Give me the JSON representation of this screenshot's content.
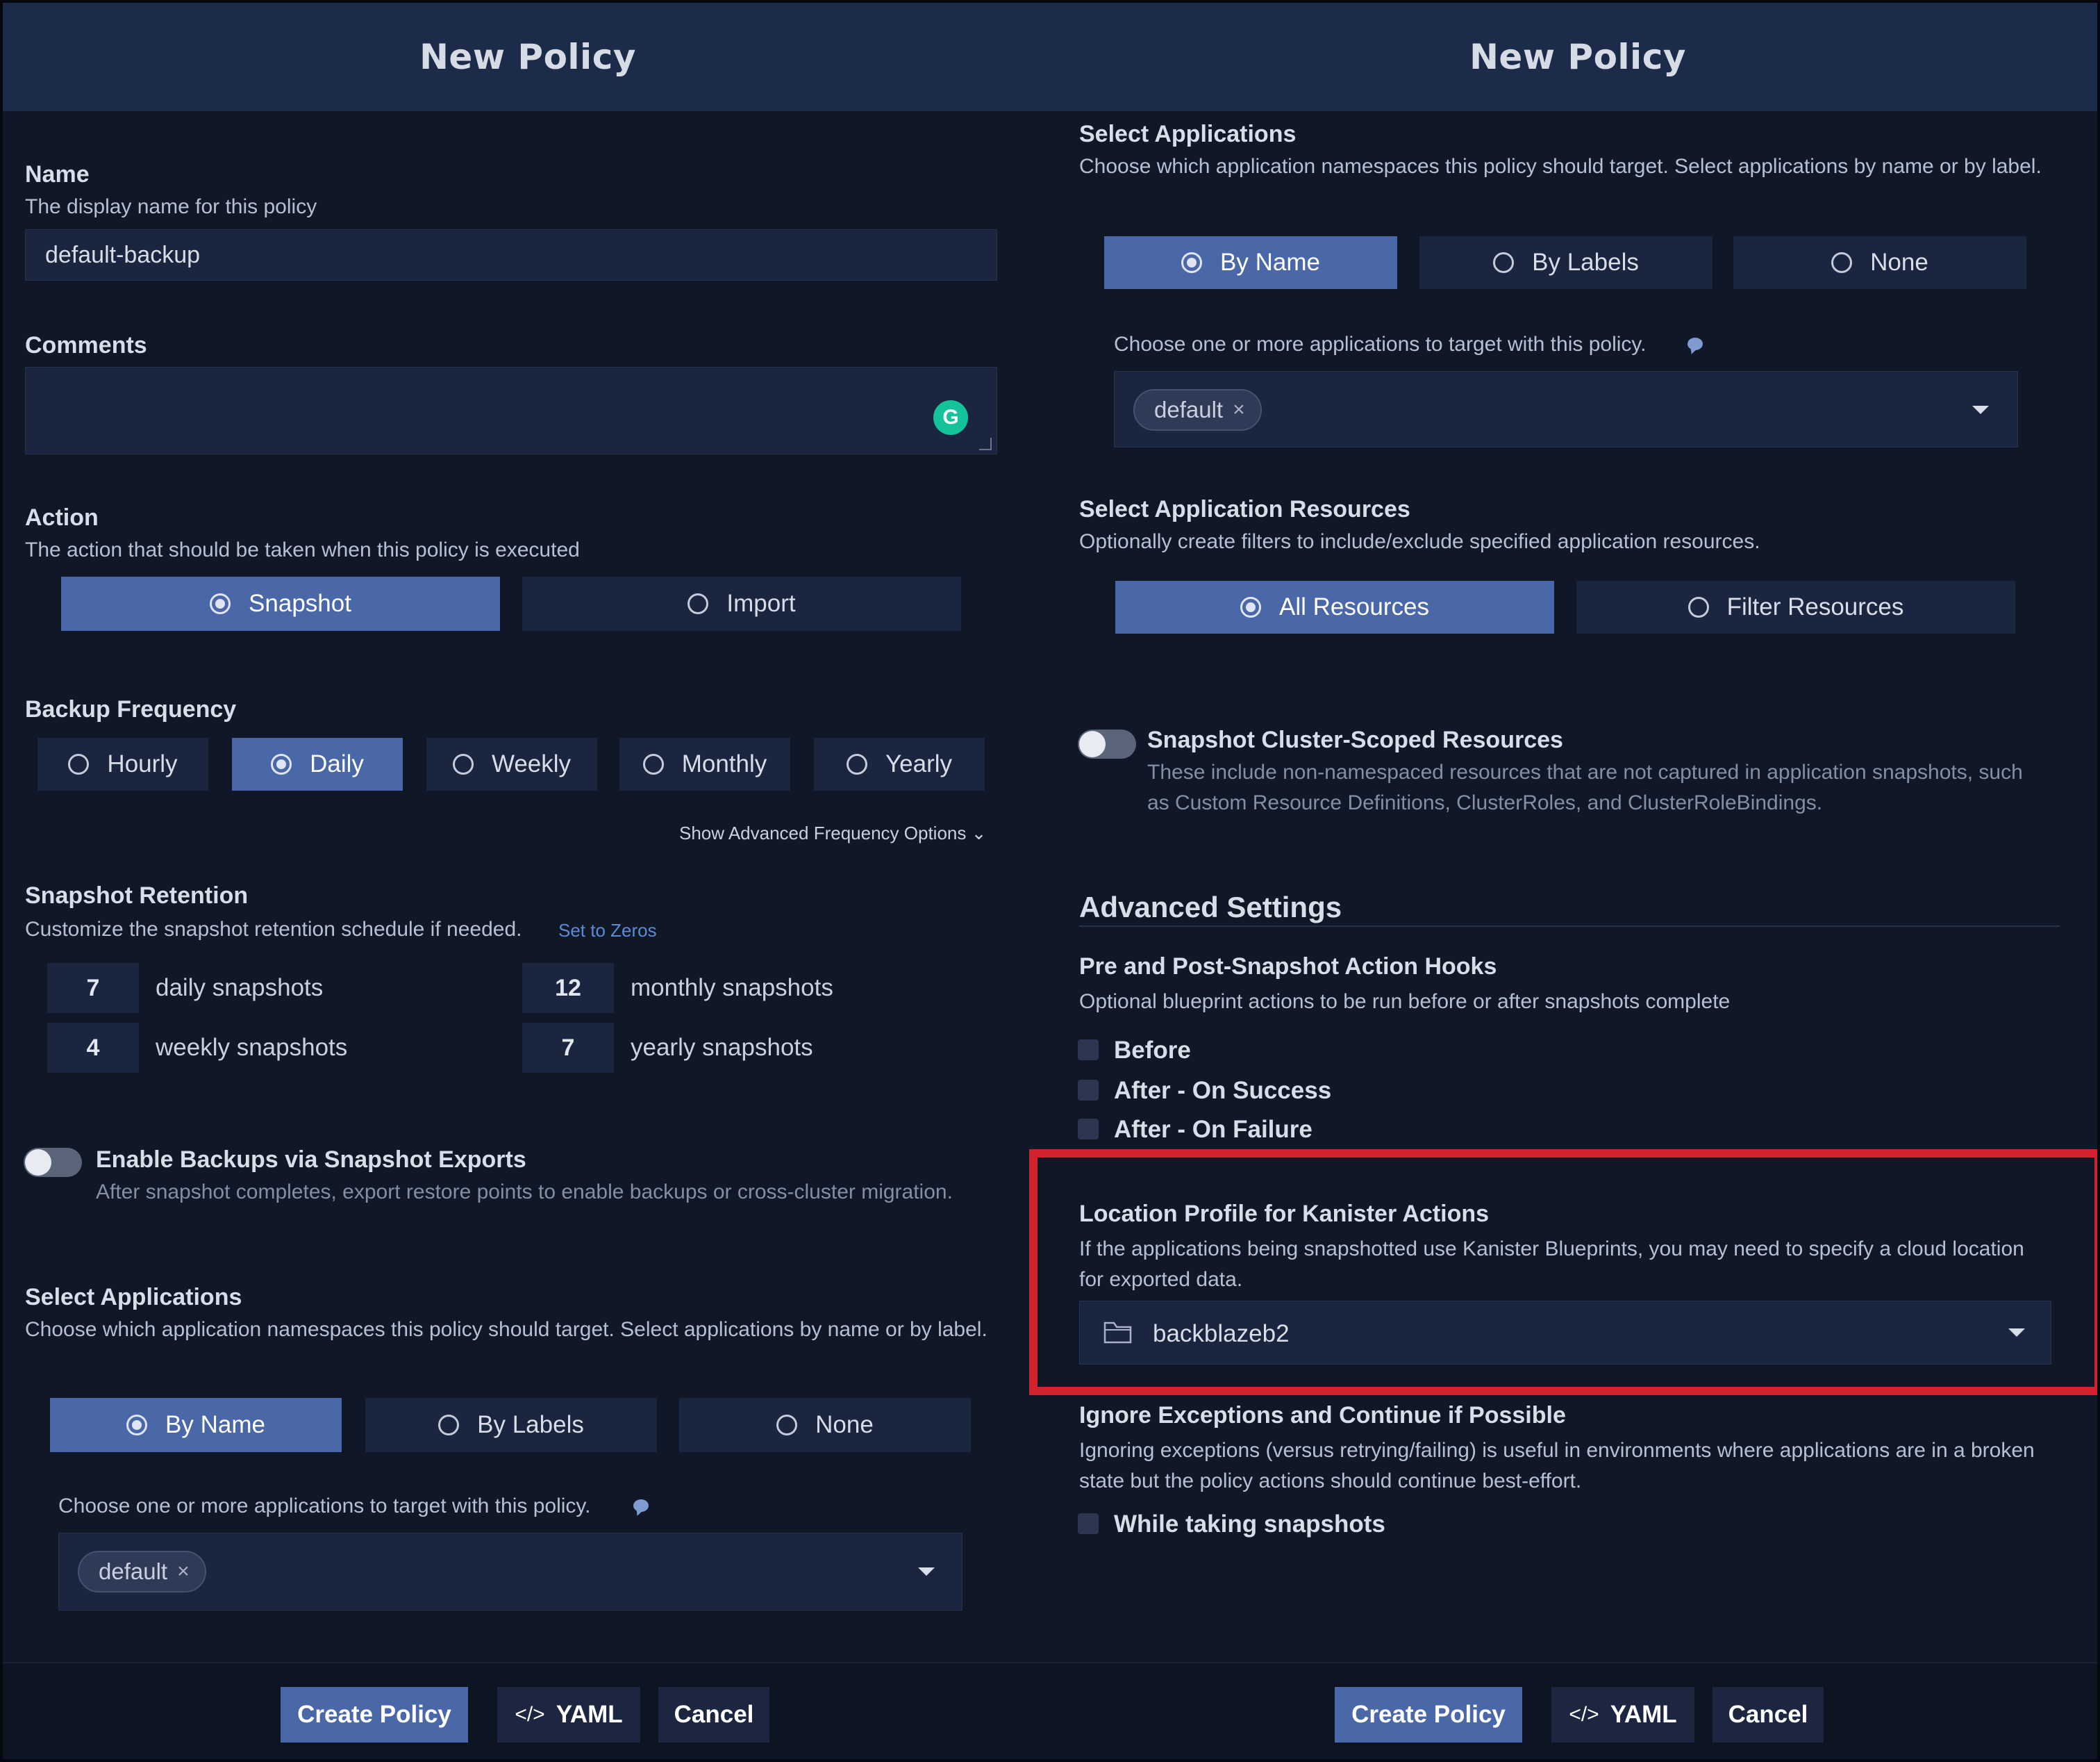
{
  "left": {
    "title": "New Policy",
    "name": {
      "label": "Name",
      "description": "The display name for this policy",
      "value": "default-backup"
    },
    "comments": {
      "label": "Comments",
      "value": "",
      "grammarly_glyph": "G"
    },
    "action": {
      "label": "Action",
      "description": "The action that should be taken when this policy is executed",
      "options": [
        "Snapshot",
        "Import"
      ],
      "selected": "Snapshot"
    },
    "frequency": {
      "label": "Backup Frequency",
      "options": [
        "Hourly",
        "Daily",
        "Weekly",
        "Monthly",
        "Yearly"
      ],
      "selected": "Daily",
      "advanced_link": "Show Advanced Frequency Options ⌄"
    },
    "retention": {
      "label": "Snapshot Retention",
      "description": "Customize the snapshot retention schedule if needed.",
      "set_zeros": "Set to Zeros",
      "daily_value": "7",
      "daily_label": "daily snapshots",
      "weekly_value": "4",
      "weekly_label": "weekly snapshots",
      "monthly_value": "12",
      "monthly_label": "monthly snapshots",
      "yearly_value": "7",
      "yearly_label": "yearly snapshots"
    },
    "exports": {
      "label": "Enable Backups via Snapshot Exports",
      "description": "After snapshot completes, export restore points to enable backups or cross-cluster migration.",
      "enabled": false
    },
    "select_apps": {
      "label": "Select Applications",
      "description": "Choose which application namespaces this policy should target. Select applications by name or by label.",
      "options": [
        "By Name",
        "By Labels",
        "None"
      ],
      "selected": "By Name",
      "choose_text": "Choose one or more applications to target with this policy.",
      "chip": "default",
      "chip_remove": "×"
    },
    "buttons": {
      "create": "Create Policy",
      "yaml": "YAML",
      "yaml_icon": "</>",
      "cancel": "Cancel"
    }
  },
  "right": {
    "title": "New Policy",
    "select_apps": {
      "label": "Select Applications",
      "description": "Choose which application namespaces this policy should target. Select applications by name or by label.",
      "options": [
        "By Name",
        "By Labels",
        "None"
      ],
      "selected": "By Name",
      "choose_text": "Choose one or more applications to target with this policy.",
      "chip": "default",
      "chip_remove": "×"
    },
    "resources": {
      "label": "Select Application Resources",
      "description": "Optionally create filters to include/exclude specified application resources.",
      "options": [
        "All Resources",
        "Filter Resources"
      ],
      "selected": "All Resources"
    },
    "cluster_scoped": {
      "label": "Snapshot Cluster-Scoped Resources",
      "description": "These include non-namespaced resources that are not captured in application snapshots, such as Custom Resource Definitions, ClusterRoles, and ClusterRoleBindings.",
      "enabled": false
    },
    "advanced": {
      "heading": "Advanced Settings"
    },
    "hooks": {
      "label": "Pre and Post-Snapshot Action Hooks",
      "description": "Optional blueprint actions to be run before or after snapshots complete",
      "before": "Before",
      "after_success": "After - On Success",
      "after_failure": "After - On Failure"
    },
    "location": {
      "label": "Location Profile for Kanister Actions",
      "description": "If the applications being snapshotted use Kanister Blueprints, you may need to specify a cloud location for exported data.",
      "value": "backblazeb2",
      "icon": "folder-icon",
      "highlight_color": "#d3212d"
    },
    "ignore": {
      "label": "Ignore Exceptions and Continue if Possible",
      "description": "Ignoring exceptions (versus retrying/failing) is useful in environments where applications are in a broken state but the policy actions should continue best-effort.",
      "checkbox": "While taking snapshots"
    },
    "buttons": {
      "create": "Create Policy",
      "yaml": "YAML",
      "yaml_icon": "</>",
      "cancel": "Cancel"
    }
  },
  "colors": {
    "accent": "#4a67a8",
    "background": "#101828",
    "header": "#1c2b49",
    "highlight": "#d3212d"
  }
}
